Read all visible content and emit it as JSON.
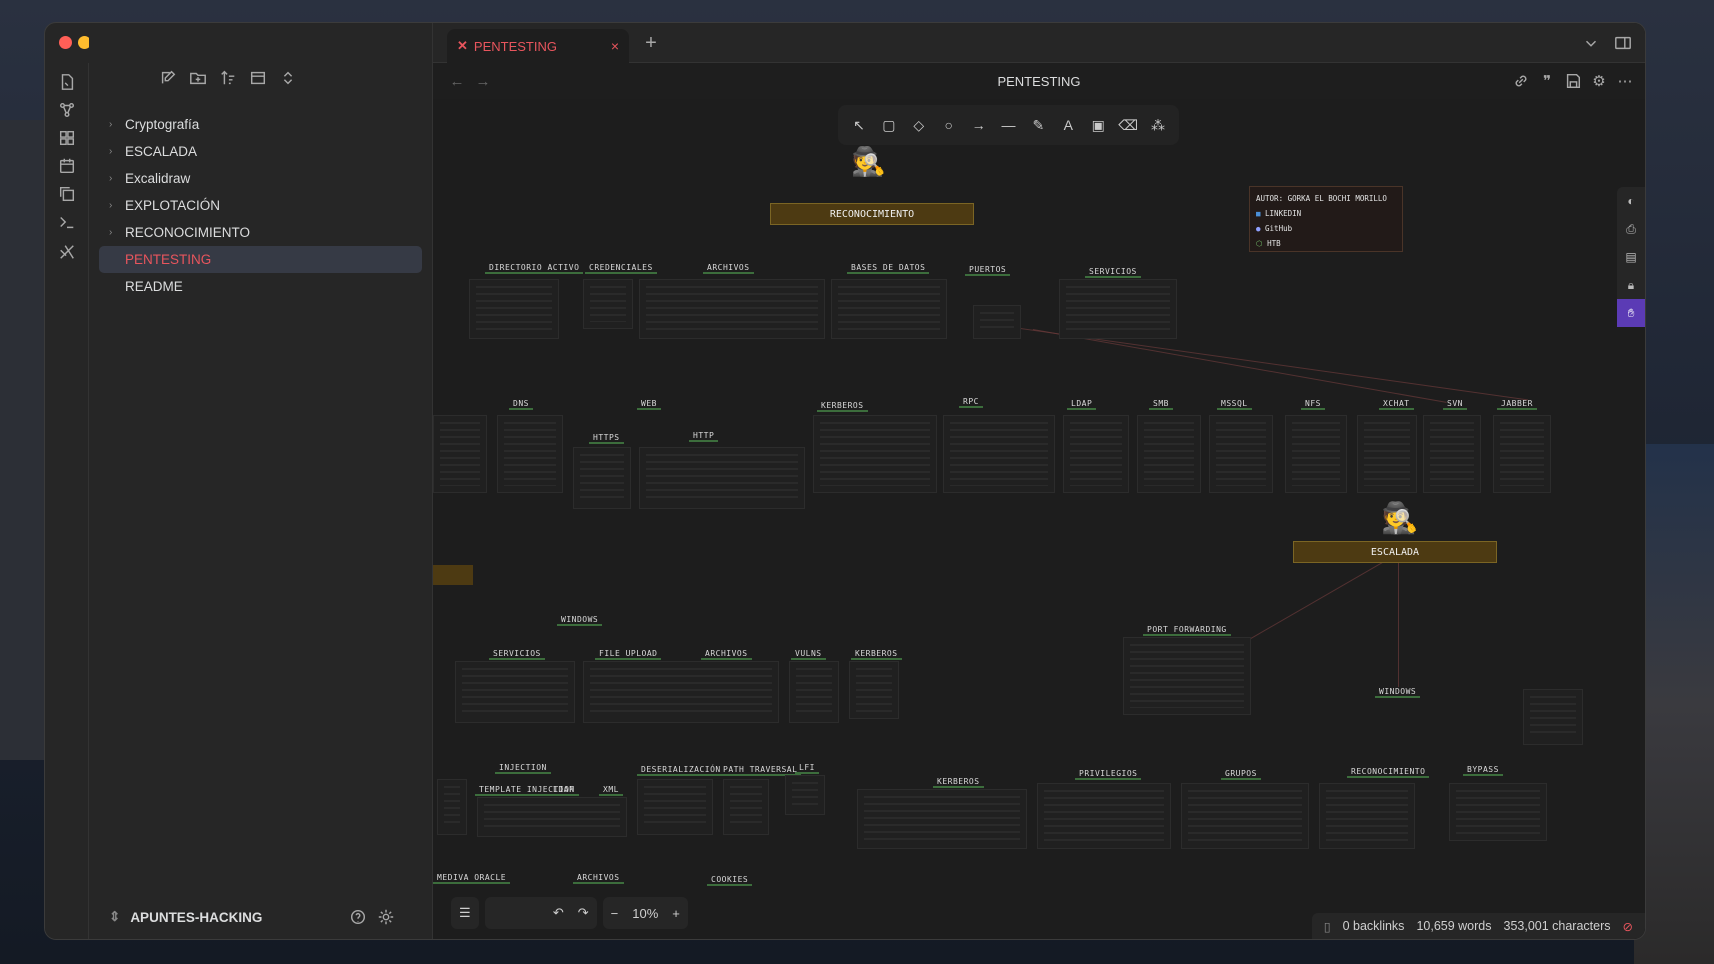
{
  "window": {
    "title": "PENTESTING"
  },
  "sidebar": {
    "items": [
      {
        "label": "Cryptografía",
        "folder": true
      },
      {
        "label": "ESCALADA",
        "folder": true
      },
      {
        "label": "Excalidraw",
        "folder": true
      },
      {
        "label": "EXPLOTACIÓN",
        "folder": true
      },
      {
        "label": "RECONOCIMIENTO",
        "folder": true
      },
      {
        "label": "PENTESTING",
        "folder": false,
        "active": true
      },
      {
        "label": "README",
        "folder": false
      }
    ],
    "vault_name": "APUNTES-HACKING"
  },
  "tabs": [
    {
      "label": "PENTESTING",
      "icon": "excalidraw-icon"
    }
  ],
  "view": {
    "title": "PENTESTING"
  },
  "canvas": {
    "banners": {
      "recon": "RECONOCIMIENTO",
      "escalada": "ESCALADA"
    },
    "author": {
      "line1": "AUTOR: GORKA EL BOCHI MORILLO",
      "linkedin": "LINKEDIN",
      "github": "GitHub",
      "htb": "HTB"
    },
    "labels_row1": [
      "DIRECTORIO ACTIVO",
      "CREDENCIALES",
      "ARCHIVOS",
      "BASES DE DATOS",
      "PUERTOS",
      "SERVICIOS"
    ],
    "labels_row2": [
      "DNS",
      "WEB",
      "HTTPS",
      "HTTP",
      "KERBEROS",
      "RPC",
      "LDAP",
      "SMB",
      "MSSQL",
      "NFS",
      "XCHAT",
      "SVN",
      "JABBER"
    ],
    "labels_row3": [
      "WINDOWS",
      "SERVICIOS",
      "FILE UPLOAD",
      "ARCHIVOS",
      "VULNS",
      "KERBEROS",
      "PORT FORWARDING",
      "WINDOWS"
    ],
    "labels_row4": [
      "INJECTION",
      "TEMPLATE INJECTION",
      "LDAP",
      "XML",
      "DESERIALIZACIÓN",
      "PATH TRAVERSAL",
      "LFI",
      "KERBEROS",
      "PRIVILEGIOS",
      "GRUPOS",
      "RECONOCIMIENTO",
      "BYPASS",
      "MEDIVA ORACLE",
      "ARCHIVOS",
      "COOKIES"
    ]
  },
  "zoom": "10%",
  "status": {
    "backlinks": "0 backlinks",
    "words": "10,659 words",
    "characters": "353,001 characters"
  },
  "colors": {
    "accent": "#e8555d",
    "banner": "#4d3a12",
    "traffic_red": "#ff5f57",
    "traffic_yellow": "#febc2e",
    "traffic_green": "#28c840"
  }
}
